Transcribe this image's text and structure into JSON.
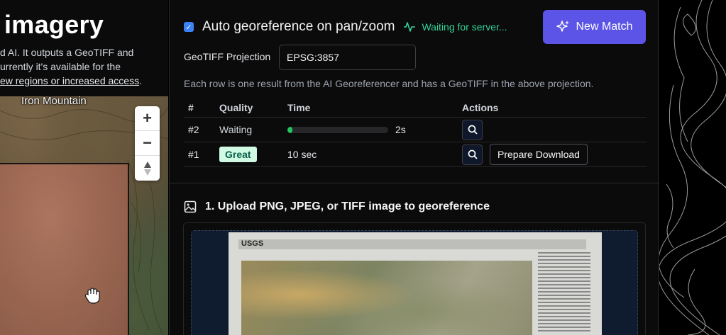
{
  "left": {
    "title": "imagery",
    "desc_line1": "d AI. It outputs a GeoTIFF and",
    "desc_line2": "urrently it's available for the",
    "desc_link": "ew regions or increased access",
    "desc_link_after": ".",
    "map_label": "Iron Mountain",
    "zoom_in": "+",
    "zoom_out": "−"
  },
  "auto": {
    "label": "Auto georeference on pan/zoom",
    "checked": true,
    "status": "Waiting for server..."
  },
  "new_match_label": "New Match",
  "projection": {
    "label": "GeoTIFF Projection",
    "value": "EPSG:3857"
  },
  "row_note": "Each row is one result from the AI Georeferencer and has a GeoTIFF in the above projection.",
  "results": {
    "headers": [
      "#",
      "Quality",
      "Time",
      "Actions"
    ],
    "rows": [
      {
        "num": "#2",
        "quality": "Waiting",
        "time": "2s",
        "progress": 0.05
      },
      {
        "num": "#1",
        "quality": "Great",
        "time": "10 sec",
        "action": "Prepare Download"
      }
    ]
  },
  "upload": {
    "title": "1. Upload PNG, JPEG, or TIFF image to georeference",
    "doc_logo": "USGS"
  },
  "colors": {
    "accent": "#5b54e6",
    "status_green": "#34d399",
    "badge_bg": "#d1fae5"
  }
}
